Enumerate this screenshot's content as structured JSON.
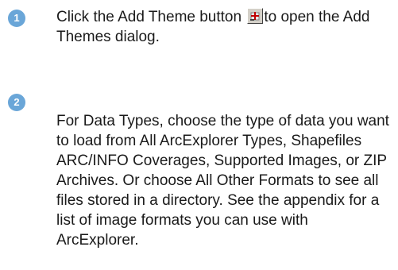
{
  "steps": [
    {
      "number": "1",
      "text_before_icon": "Click the Add Theme button ",
      "icon": "add-theme-icon",
      "text_after_icon": "to open the Add Themes dialog."
    },
    {
      "number": "2",
      "text": "For Data Types, choose the type of data you want to load from All ArcExplorer Types, Shapefiles ARC/INFO Coverages, Supported Images, or ZIP Archives. Or choose All Other Formats to see all files stored in a directory. See the appendix for a list of image formats you can use with ArcExplorer."
    }
  ],
  "colors": {
    "badge": "#6aa6d8",
    "text": "#1a1a1a"
  }
}
